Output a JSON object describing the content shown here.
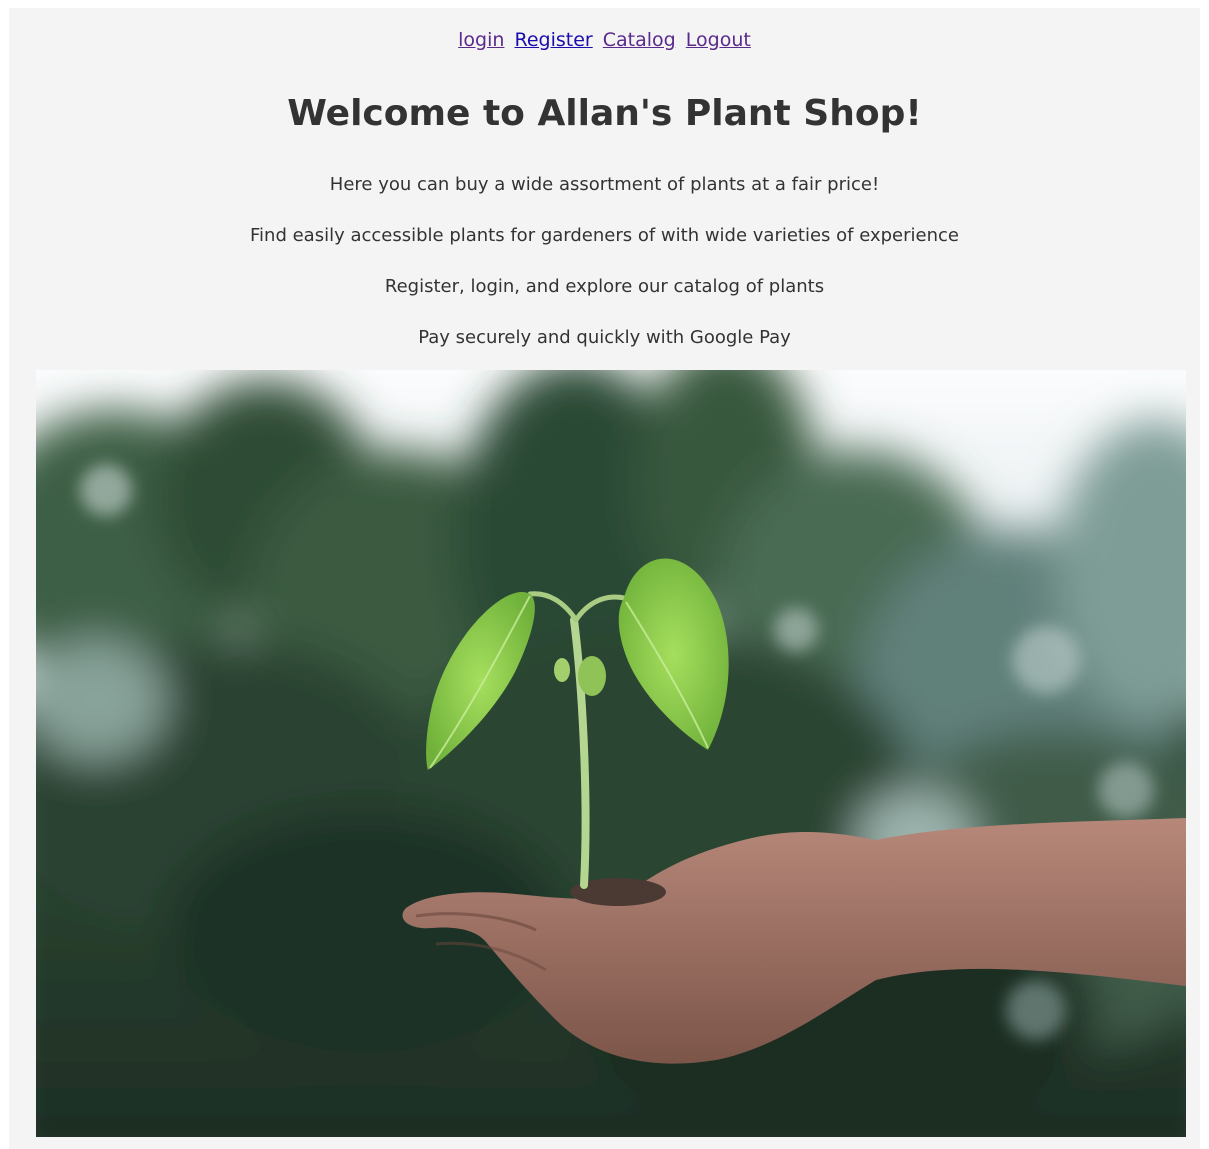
{
  "nav": {
    "login": "login",
    "register": "Register",
    "catalog": "Catalog",
    "logout": "Logout"
  },
  "title": "Welcome to Allan's Plant Shop!",
  "lines": [
    "Here you can buy a wide assortment of plants at a fair price!",
    "Find easily accessible plants for gardeners of with wide varieties of experience",
    "Register, login, and explore our catalog of plants",
    "Pay securely and quickly with Google Pay"
  ],
  "colors": {
    "link": "#1a0dab",
    "link_visited": "#5a2a8c",
    "page_bg": "#f4f4f4",
    "text": "#333333",
    "leaf": "#8ccc48"
  },
  "hero_image": "seedling-in-hand-photo"
}
